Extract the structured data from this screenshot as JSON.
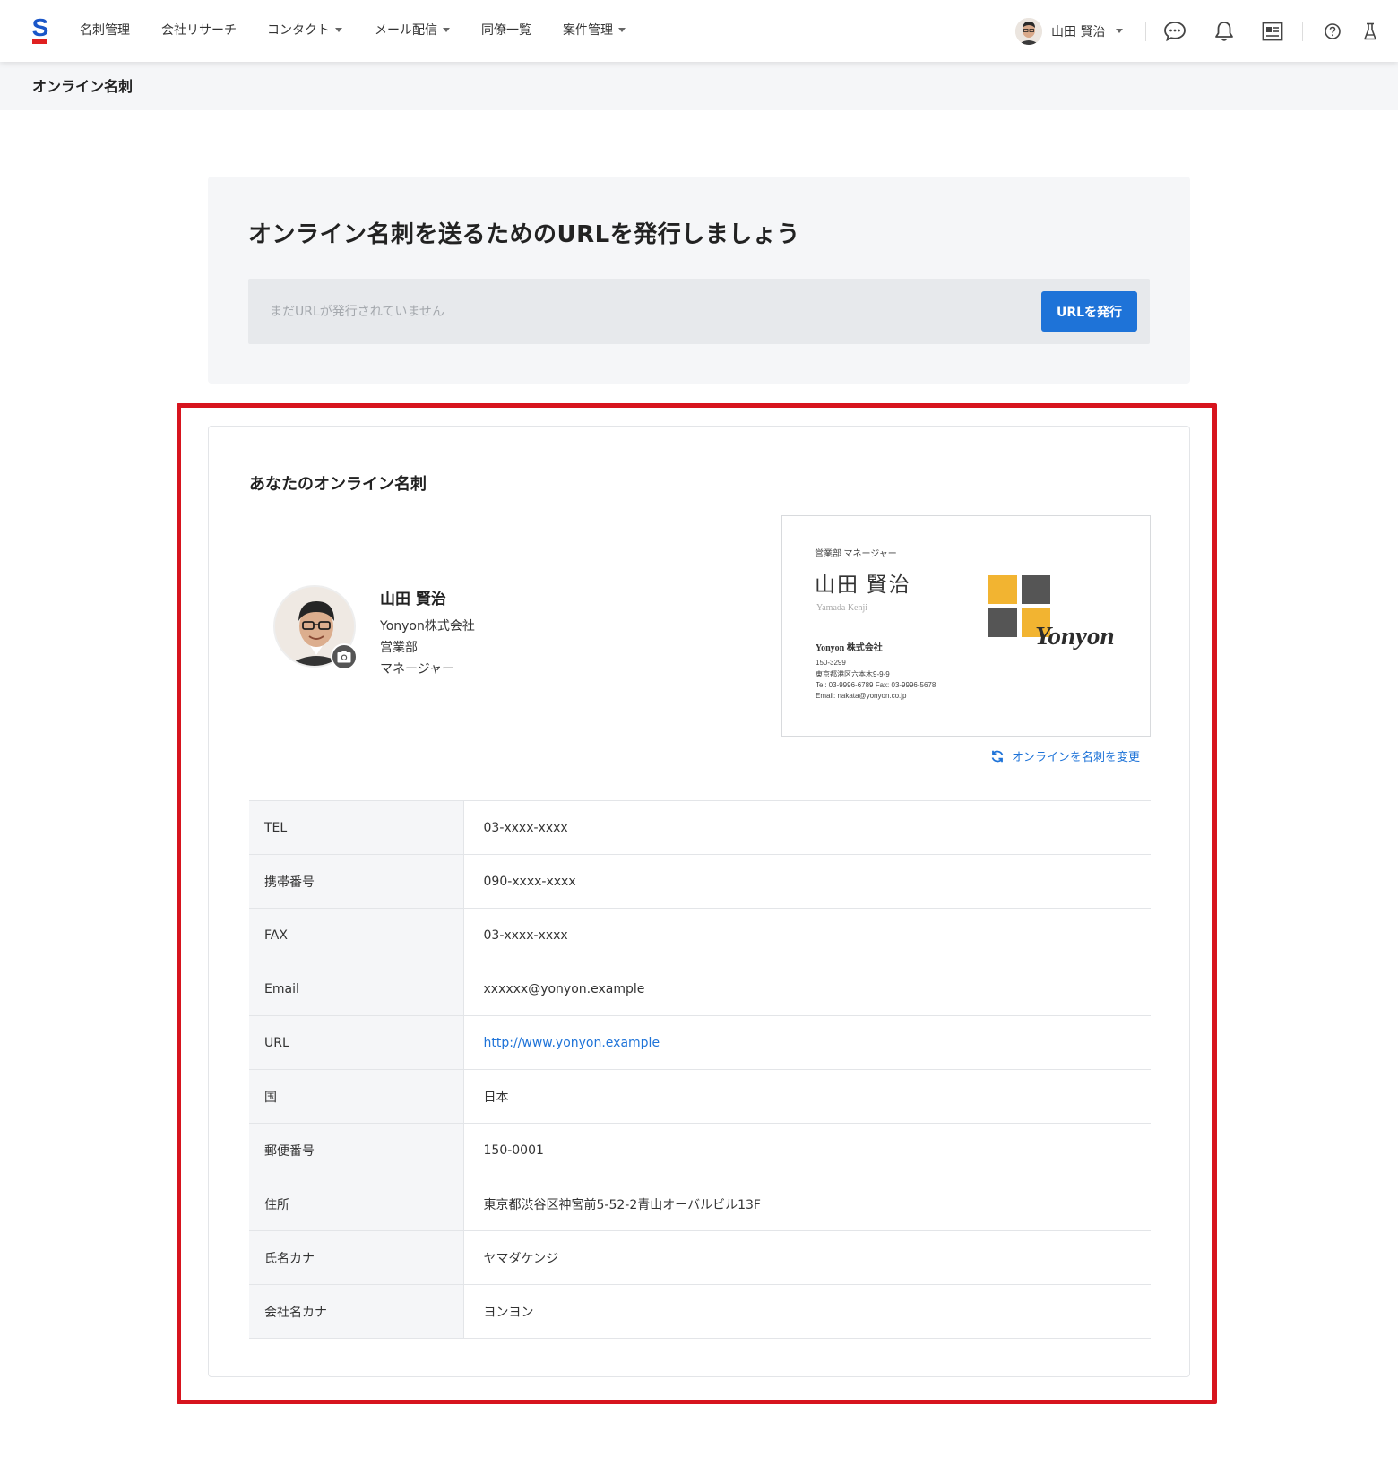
{
  "nav": {
    "items": [
      {
        "label": "名刺管理",
        "dropdown": false
      },
      {
        "label": "会社リサーチ",
        "dropdown": false
      },
      {
        "label": "コンタクト",
        "dropdown": true
      },
      {
        "label": "メール配信",
        "dropdown": true
      },
      {
        "label": "同僚一覧",
        "dropdown": false
      },
      {
        "label": "案件管理",
        "dropdown": true
      }
    ],
    "user_name": "山田 賢治",
    "icons": [
      "chat-icon",
      "bell-icon",
      "card-list-icon",
      "help-icon",
      "flask-icon"
    ]
  },
  "page": {
    "title": "オンライン名刺"
  },
  "url_panel": {
    "heading": "オンライン名刺を送るためのURLを発行しましょう",
    "placeholder": "まだURLが発行されていません",
    "button_label": "URLを発行"
  },
  "card": {
    "title": "あなたのオンライン名刺",
    "profile": {
      "name": "山田 賢治",
      "company": "Yonyon株式会社",
      "department": "営業部",
      "position": "マネージャー"
    },
    "business_card": {
      "role": "営業部 マネージャー",
      "name": "山田 賢治",
      "romaji": "Yamada Kenji",
      "company": "Yonyon 株式会社",
      "zip": "150-3299",
      "address": "東京都港区六本木9-9-9",
      "tel_fax": "Tel: 03-9996-6789   Fax: 03-9996-5678",
      "email": "Email: nakata@yonyon.co.jp",
      "brand": "Yonyon"
    },
    "change_link": "オンラインを名刺を変更",
    "fields": [
      {
        "label": "TEL",
        "value": "03-xxxx-xxxx"
      },
      {
        "label": "携帯番号",
        "value": "090-xxxx-xxxx"
      },
      {
        "label": "FAX",
        "value": "03-xxxx-xxxx"
      },
      {
        "label": "Email",
        "value": "xxxxxx@yonyon.example"
      },
      {
        "label": "URL",
        "value": "http://www.yonyon.example"
      },
      {
        "label": "国",
        "value": "日本"
      },
      {
        "label": "郵便番号",
        "value": "150-0001"
      },
      {
        "label": "住所",
        "value": "東京都渋谷区神宮前5-52-2青山オーバルビル13F"
      },
      {
        "label": "氏名カナ",
        "value": "ヤマダケンジ"
      },
      {
        "label": "会社名カナ",
        "value": "ヨンヨン"
      }
    ]
  },
  "colors": {
    "accent": "#1e73d8",
    "highlight": "#d7141e",
    "logo_yellow": "#f2b431",
    "logo_gray": "#555555"
  }
}
